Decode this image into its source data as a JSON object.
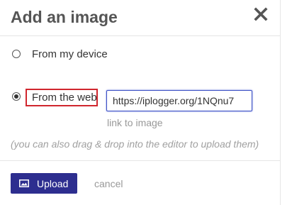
{
  "dialog": {
    "title": "Add an image",
    "close_icon": "close-icon"
  },
  "options": {
    "device_label": "From my device",
    "web_label": "From the web",
    "selected": "web"
  },
  "url": {
    "value": "https://iplogger.org/1NQnu7",
    "hint": "link to image"
  },
  "note": "(you can also drag & drop into the editor to upload them)",
  "footer": {
    "upload_label": "Upload",
    "upload_icon": "image-icon",
    "cancel_label": "cancel"
  },
  "colors": {
    "primary_button": "#2d2e8f",
    "highlight_border": "#d0262e",
    "input_focus_border": "#3b4fc4"
  }
}
